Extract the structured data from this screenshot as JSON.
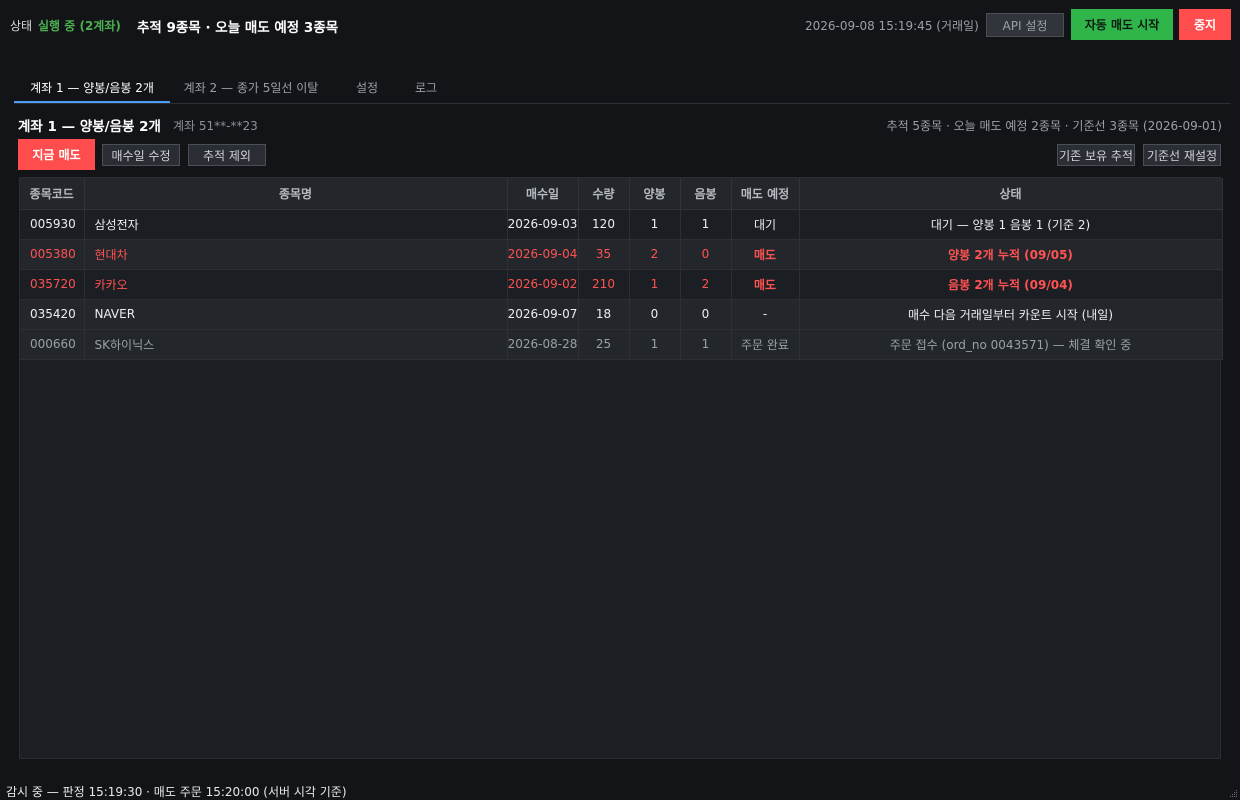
{
  "header": {
    "status_label": "상태",
    "status_value": "실행 중 (2계좌)",
    "headline": "추적 9종목 · 오늘 매도 예정 3종목",
    "clock": "2026-09-08 15:19:45  (거래일)",
    "api_button": "API 설정",
    "start_button": "자동 매도 시작",
    "stop_button": "중지"
  },
  "tabs": [
    {
      "label": "계좌 1 — 양봉/음봉 2개",
      "active": true
    },
    {
      "label": "계좌 2 — 종가 5일선 이탈",
      "active": false
    },
    {
      "label": "설정",
      "active": false
    },
    {
      "label": "로그",
      "active": false
    }
  ],
  "account": {
    "title": "계좌 1 — 양봉/음봉 2개",
    "number": "계좌 51**-**23",
    "summary": "추적 5종목 · 오늘 매도 예정 2종목 · 기준선 3종목 (2026-09-01)",
    "sell_now_button": "지금 매도",
    "edit_date_button": "매수일 수정",
    "untrack_button": "추적 제외",
    "track_held_button": "기존 보유 추적",
    "reset_base_button": "기준선 재설정"
  },
  "table": {
    "headers": [
      "종목코드",
      "종목명",
      "매수일",
      "수량",
      "양봉",
      "음봉",
      "매도 예정",
      "상태"
    ],
    "rows": [
      {
        "code": "005930",
        "name": "삼성전자",
        "date": "2026-09-03",
        "qty": "120",
        "up": "1",
        "down": "1",
        "sell": "대기",
        "status": "대기 — 양봉 1 음봉 1 (기준 2)",
        "kind": "normal"
      },
      {
        "code": "005380",
        "name": "현대차",
        "date": "2026-09-04",
        "qty": "35",
        "up": "2",
        "down": "0",
        "sell": "매도",
        "status": "양봉 2개 누적 (09/05)",
        "kind": "sell"
      },
      {
        "code": "035720",
        "name": "카카오",
        "date": "2026-09-02",
        "qty": "210",
        "up": "1",
        "down": "2",
        "sell": "매도",
        "status": "음봉 2개 누적 (09/04)",
        "kind": "sell"
      },
      {
        "code": "035420",
        "name": "NAVER",
        "date": "2026-09-07",
        "qty": "18",
        "up": "0",
        "down": "0",
        "sell": "-",
        "status": "매수 다음 거래일부터 카운트 시작 (내일)",
        "kind": "alt"
      },
      {
        "code": "000660",
        "name": "SK하이닉스",
        "date": "2026-08-28",
        "qty": "25",
        "up": "1",
        "down": "1",
        "sell": "주문 완료",
        "status": "주문 접수 (ord_no 0043571) — 체결 확인 중",
        "kind": "done"
      }
    ]
  },
  "footer": {
    "text": "감시 중 — 판정 15:19:30 · 매도 주문 15:20:00 (서버 시각 기준)"
  },
  "colors": {
    "accent_green": "#2fb54a",
    "accent_red": "#ff4d4d",
    "sell_text": "#ff5252",
    "tab_underline": "#4b9cf5"
  }
}
